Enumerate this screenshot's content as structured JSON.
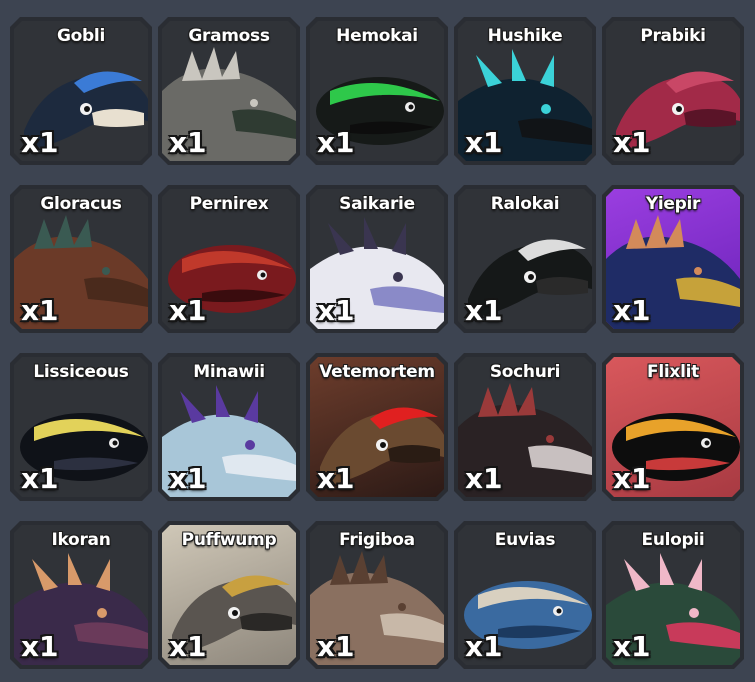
{
  "inventory": {
    "items": [
      {
        "name": "Gobli",
        "count": "x1",
        "colors": [
          "#1d2a3e",
          "#3b7bd6",
          "#e8e0d0"
        ],
        "bg": "dark"
      },
      {
        "name": "Gramoss",
        "count": "x1",
        "colors": [
          "#6a6a66",
          "#c9c6bf",
          "#2f3b32"
        ],
        "bg": "dark"
      },
      {
        "name": "Hemokai",
        "count": "x1",
        "colors": [
          "#161a18",
          "#2ec84a",
          "#0d0d0d"
        ],
        "bg": "dark"
      },
      {
        "name": "Hushike",
        "count": "x1",
        "colors": [
          "#0f2230",
          "#3bd2d8",
          "#111417"
        ],
        "bg": "dark"
      },
      {
        "name": "Prabiki",
        "count": "x1",
        "colors": [
          "#a22a48",
          "#c94766",
          "#5a1428"
        ],
        "bg": "dark"
      },
      {
        "name": "Gloracus",
        "count": "x1",
        "colors": [
          "#6b3a28",
          "#3a5a52",
          "#4a2a1c"
        ],
        "bg": "dark"
      },
      {
        "name": "Pernirex",
        "count": "x1",
        "colors": [
          "#7a1a1e",
          "#c0392b",
          "#3a0c0e"
        ],
        "bg": "dark"
      },
      {
        "name": "Saikarie",
        "count": "x1",
        "colors": [
          "#e8e8f0",
          "#3a3550",
          "#8a8ac8"
        ],
        "bg": "dark"
      },
      {
        "name": "Ralokai",
        "count": "x1",
        "colors": [
          "#151818",
          "#dcdcdc",
          "#2a2a2a"
        ],
        "bg": "dark"
      },
      {
        "name": "Yiepir",
        "count": "x1",
        "colors": [
          "#1f2c66",
          "#d38a5a",
          "#c6a23a"
        ],
        "bg": "purple"
      },
      {
        "name": "Lissiceous",
        "count": "x1",
        "colors": [
          "#0f1218",
          "#e2d25a",
          "#2c3040"
        ],
        "bg": "dark"
      },
      {
        "name": "Minawii",
        "count": "x1",
        "colors": [
          "#a8c6d8",
          "#5a3aa0",
          "#e0e8f0"
        ],
        "bg": "dark"
      },
      {
        "name": "Vetemortem",
        "count": "x1",
        "colors": [
          "#6a4a30",
          "#e02020",
          "#2a1c14"
        ],
        "bg": "brown"
      },
      {
        "name": "Sochuri",
        "count": "x1",
        "colors": [
          "#2a2224",
          "#9a3a3a",
          "#c8c0c0"
        ],
        "bg": "dark"
      },
      {
        "name": "Flixlit",
        "count": "x1",
        "colors": [
          "#0d0d0d",
          "#e8a22a",
          "#c83a3a"
        ],
        "bg": "red"
      },
      {
        "name": "Ikoran",
        "count": "x1",
        "colors": [
          "#3a2a4a",
          "#d89a6a",
          "#6a3a5a"
        ],
        "bg": "dark"
      },
      {
        "name": "Puffwump",
        "count": "x1",
        "colors": [
          "#5a5550",
          "#c8a040",
          "#2a2826"
        ],
        "bg": "tan"
      },
      {
        "name": "Frigiboa",
        "count": "x1",
        "colors": [
          "#8a7060",
          "#5a4032",
          "#c8b8a8"
        ],
        "bg": "dark"
      },
      {
        "name": "Euvias",
        "count": "x1",
        "colors": [
          "#3a6aa0",
          "#d8d0c0",
          "#1c3a60"
        ],
        "bg": "dark"
      },
      {
        "name": "Eulopii",
        "count": "x1",
        "colors": [
          "#2a4a3a",
          "#f0b8c8",
          "#c83a5a"
        ],
        "bg": "dark"
      }
    ]
  }
}
